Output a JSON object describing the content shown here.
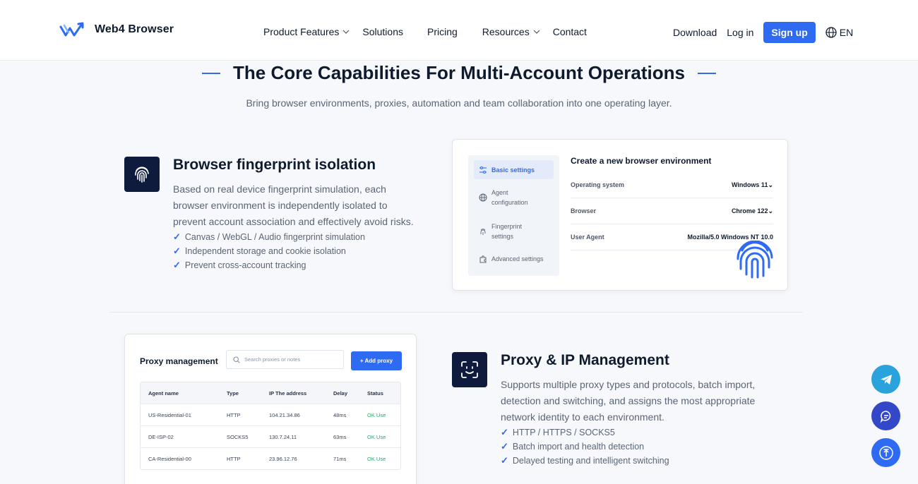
{
  "header": {
    "logo_text": "Web4 Browser",
    "nav": [
      {
        "label": "Product Features",
        "has_dropdown": true
      },
      {
        "label": "Solutions",
        "has_dropdown": false
      },
      {
        "label": "Pricing",
        "has_dropdown": false
      },
      {
        "label": "Resources",
        "has_dropdown": true
      },
      {
        "label": "Contact",
        "has_dropdown": false
      }
    ],
    "download": "Download",
    "login": "Log in",
    "signup": "Sign up",
    "lang": "EN"
  },
  "section": {
    "title": "The Core Capabilities For Multi-Account Operations",
    "subtitle": "Bring browser environments, proxies, automation and team collaboration into one operating layer."
  },
  "feature1": {
    "icon": "fingerprint-icon",
    "title": "Browser fingerprint isolation",
    "desc_lines": [
      "Based on real device fingerprint simulation, each",
      "browser environment is independently isolated to",
      "prevent account association and effectively avoid risks."
    ],
    "bullets": [
      "Canvas / WebGL / Audio fingerprint simulation",
      "Independent storage and cookie isolation",
      "Prevent cross-account tracking"
    ],
    "card": {
      "menu": [
        {
          "label": "Basic settings",
          "icon": "sliders-icon"
        },
        {
          "label": "Agent configuration",
          "icon": "globe-icon"
        },
        {
          "label": "Fingerprint settings",
          "icon": "fingerprint-icon"
        },
        {
          "label": "Advanced settings",
          "icon": "puzzle-icon"
        }
      ],
      "title": "Create a new browser environment",
      "rows": [
        {
          "key": "Operating system",
          "value": "Windows 11⌄"
        },
        {
          "key": "Browser",
          "value": "Chrome 122⌄"
        },
        {
          "key": "User Agent",
          "value": "Mozilla/5.0 Windows NT 10.0"
        }
      ]
    }
  },
  "feature2": {
    "icon": "face-scan-icon",
    "title": "Proxy & IP Management",
    "desc_lines": [
      "Supports multiple proxy types and protocols, batch import,",
      "detection and switching, and assigns the most appropriate",
      "network identity to each environment."
    ],
    "bullets": [
      "HTTP / HTTPS / SOCKS5",
      "Batch import and health detection",
      "Delayed testing and intelligent switching"
    ],
    "card": {
      "title": "Proxy management",
      "search_placeholder": "Search proxies or notes",
      "add_button": "+ Add proxy",
      "columns": [
        "Agent name",
        "Type",
        "IP The address",
        "Delay",
        "Status"
      ],
      "rows": [
        [
          "US-Residential-01",
          "HTTP",
          "104.21.34.86",
          "48ms",
          "OK Use"
        ],
        [
          "DE-ISP-02",
          "SOCKS5",
          "130.7.24.11",
          "63ms",
          "OK Use"
        ],
        [
          "CA-Residential-00",
          "HTTP",
          "23.96.12.76",
          "71ms",
          "OK Use"
        ]
      ]
    }
  },
  "colors": {
    "accent": "#2f6bf2",
    "dark_tile": "#0f1b3c",
    "status_ok": "#1ea86a",
    "telegram": "#2aa3dc",
    "chat": "#3347c9"
  },
  "floating": [
    "telegram-icon",
    "chat-icon",
    "scroll-top-icon"
  ]
}
